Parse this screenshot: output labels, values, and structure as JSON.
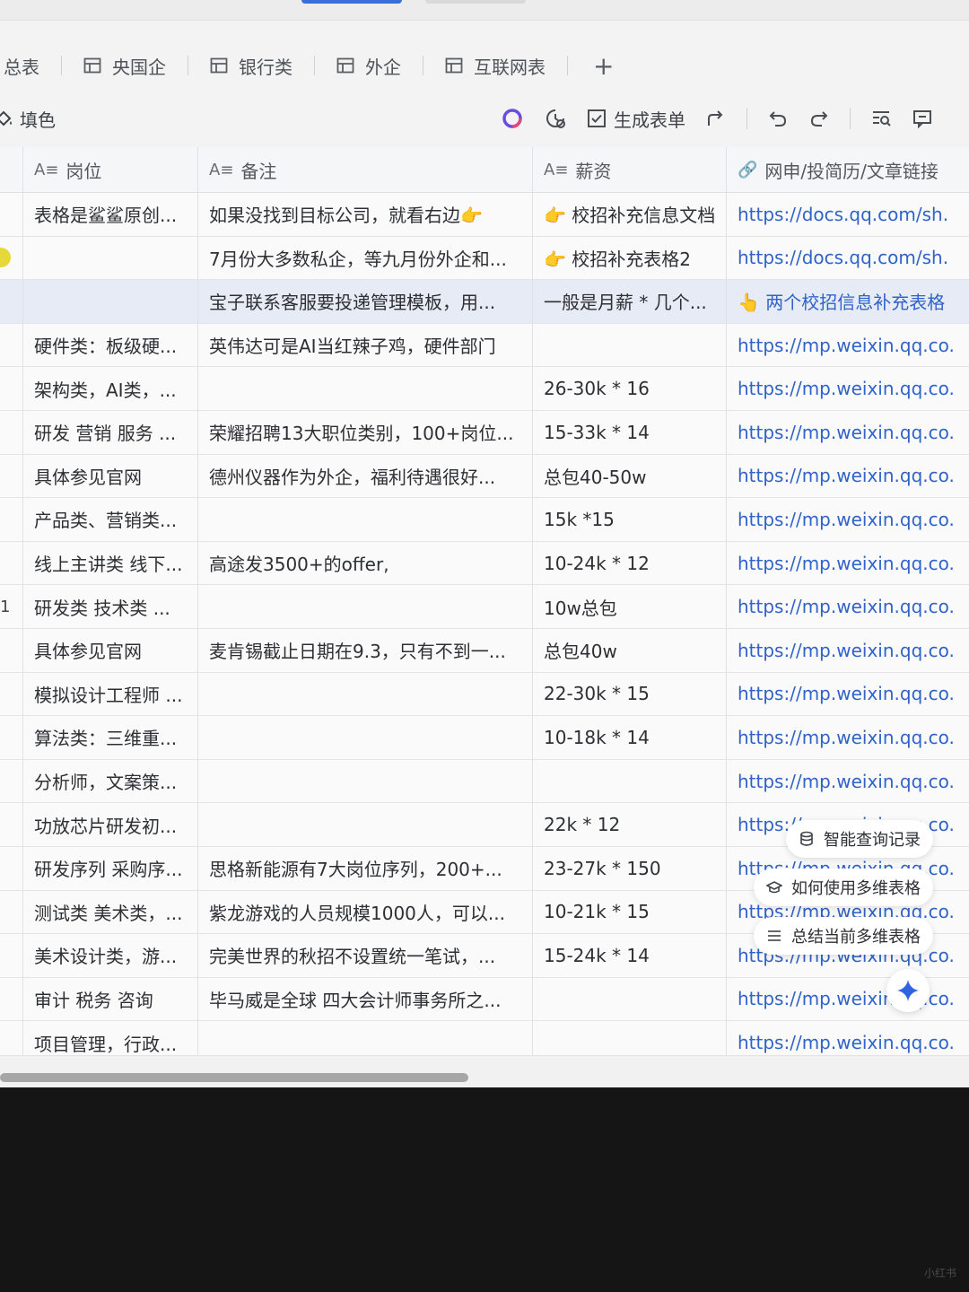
{
  "tabs": [
    "总表",
    "央国企",
    "银行类",
    "外企",
    "互联网表"
  ],
  "tab_add": "+",
  "toolbar": {
    "fill": "填色",
    "generate_form": "生成表单"
  },
  "columns": [
    "岗位",
    "备注",
    "薪资",
    "网申/投简历/文章链接"
  ],
  "rows": [
    {
      "num": "",
      "c1": "表格是鲨鲨原创...",
      "c2": "如果没找到目标公司，就看右边👉",
      "c3": "👉 校招补充信息文档",
      "c4": "https://docs.qq.com/sh."
    },
    {
      "num": "",
      "c1": "",
      "c2": "7月份大多数私企，等九月份外企和...",
      "c3": "👉 校招补充表格2",
      "c4": "https://docs.qq.com/sh."
    },
    {
      "num": "",
      "c1": "",
      "c2": "宝子联系客服要投递管理模板，用...",
      "c3": "一般是月薪 * 几个...",
      "c4": "👆 两个校招信息补充表格"
    },
    {
      "num": "",
      "c1": "硬件类：板级硬...",
      "c2": "英伟达可是AI当红辣子鸡，硬件部门",
      "c3": "",
      "c4": "https://mp.weixin.qq.co."
    },
    {
      "num": "",
      "c1": "架构类，AI类，...",
      "c2": "",
      "c3": "26-30k * 16",
      "c4": "https://mp.weixin.qq.co."
    },
    {
      "num": "",
      "c1": "研发 营销 服务 ...",
      "c2": "荣耀招聘13大职位类别，100+岗位...",
      "c3": "15-33k * 14",
      "c4": "https://mp.weixin.qq.co."
    },
    {
      "num": "",
      "c1": "具体参见官网",
      "c2": "德州仪器作为外企，福利待遇很好...",
      "c3": "总包40-50w",
      "c4": "https://mp.weixin.qq.co."
    },
    {
      "num": "",
      "c1": "产品类、营销类...",
      "c2": "",
      "c3": "15k *15",
      "c4": "https://mp.weixin.qq.co."
    },
    {
      "num": "",
      "c1": "线上主讲类 线下...",
      "c2": "高途发3500+的offer,",
      "c3": "10-24k * 12",
      "c4": "https://mp.weixin.qq.co."
    },
    {
      "num": "1",
      "c1": "研发类 技术类 ...",
      "c2": "",
      "c3": "10w总包",
      "c4": "https://mp.weixin.qq.co."
    },
    {
      "num": "",
      "c1": "具体参见官网",
      "c2": "麦肯锡截止日期在9.3，只有不到一...",
      "c3": "总包40w",
      "c4": "https://mp.weixin.qq.co."
    },
    {
      "num": "",
      "c1": "模拟设计工程师 ...",
      "c2": "",
      "c3": "22-30k * 15",
      "c4": "https://mp.weixin.qq.co."
    },
    {
      "num": "",
      "c1": "算法类：三维重...",
      "c2": "",
      "c3": "10-18k * 14",
      "c4": "https://mp.weixin.qq.co."
    },
    {
      "num": "",
      "c1": "分析师，文案策...",
      "c2": "",
      "c3": "",
      "c4": "https://mp.weixin.qq.co."
    },
    {
      "num": "",
      "c1": "功放芯片研发初...",
      "c2": "",
      "c3": "22k * 12",
      "c4": "https://mp.weixin.qq.co."
    },
    {
      "num": "",
      "c1": "研发序列 采购序...",
      "c2": "思格新能源有7大岗位序列，200+...",
      "c3": "23-27k * 150",
      "c4": "https://mp.weixin.qq.co."
    },
    {
      "num": "",
      "c1": "测试类 美术类，...",
      "c2": "紫龙游戏的人员规模1000人，可以...",
      "c3": "10-21k * 15",
      "c4": "https://mp.weixin.qq.co."
    },
    {
      "num": "",
      "c1": "美术设计类，游...",
      "c2": "完美世界的秋招不设置统一笔试，...",
      "c3": "15-24k * 14",
      "c4": "https://mp.weixin.qq.co."
    },
    {
      "num": "",
      "c1": "审计 税务 咨询",
      "c2": "毕马威是全球 四大会计师事务所之...",
      "c3": "",
      "c4": "https://mp.weixin.qq.co."
    },
    {
      "num": "",
      "c1": "项目管理，行政...",
      "c2": "",
      "c3": "",
      "c4": "https://mp.weixin.qq.co."
    }
  ],
  "ai_menu": [
    "智能查询记录",
    "如何使用多维表格",
    "总结当前多维表格"
  ],
  "watermark": "小红书"
}
